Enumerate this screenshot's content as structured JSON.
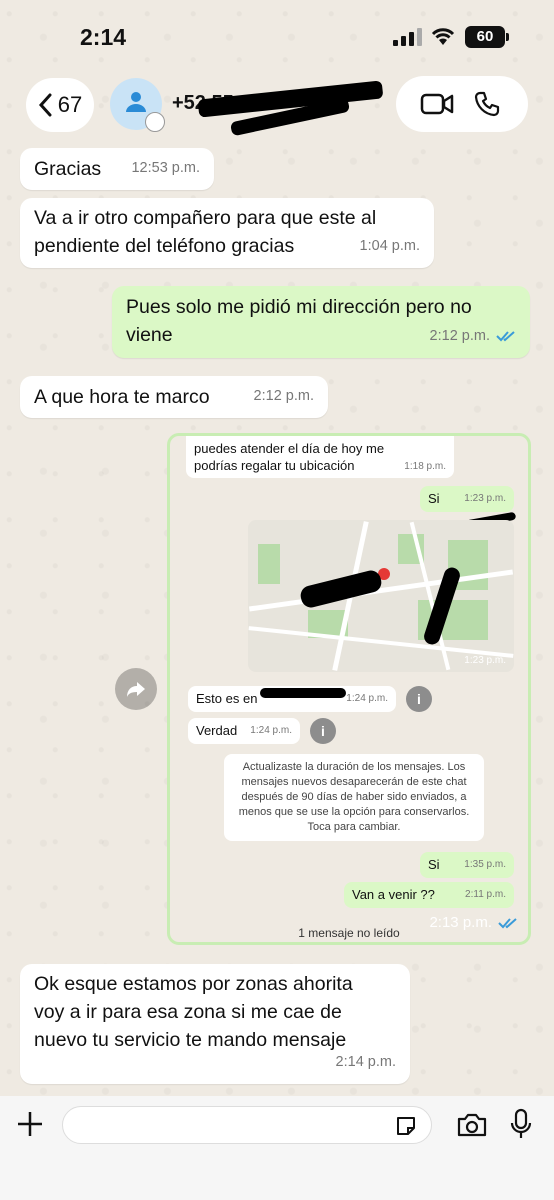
{
  "status_bar": {
    "time": "2:14",
    "battery": "60"
  },
  "header": {
    "back_count": "67",
    "contact_name": "+52 55",
    "icons": {
      "back": "chevron-left-icon",
      "video": "video-call-icon",
      "phone": "phone-icon",
      "timer": "disappearing-timer-icon"
    }
  },
  "messages": [
    {
      "dir": "in",
      "text": "Gracias",
      "time": "12:53 p.m."
    },
    {
      "dir": "in",
      "text": "Va a ir otro compañero para que este al\npendiente del teléfono gracias",
      "time": "1:04 p.m."
    },
    {
      "dir": "out",
      "text": "Pues solo me pidió mi dirección pero no\nviene",
      "time": "2:12 p.m."
    },
    {
      "dir": "in",
      "text": "A que hora te marco",
      "time": "2:12 p.m."
    },
    {
      "dir": "in",
      "text": "Ok esque estamos por zonas ahorita\nvoy a ir para esa zona si me cae de\nnuevo tu servicio te mando mensaje",
      "time": "2:14 p.m."
    }
  ],
  "embedded": {
    "msg1": {
      "text": "puedes atender el día de hoy me\npodrías regalar tu ubicación",
      "time": "1:18 p.m."
    },
    "msg2": {
      "text": "Si",
      "time": "1:23 p.m."
    },
    "map_time": "1:23 p.m.",
    "msg3": {
      "text": "Esto es en",
      "time": "1:24 p.m."
    },
    "msg4": {
      "text": "Verdad",
      "time": "1:24 p.m."
    },
    "system_note": "Actualizaste la duración de los mensajes. Los mensajes nuevos desaparecerán de este chat después de 90 días de haber sido enviados, a menos que se use la opción para conservarlos. Toca para cambiar.",
    "msg5": {
      "text": "Si",
      "time": "1:35 p.m."
    },
    "msg6": {
      "text": "Van a venir ??",
      "time": "2:11 p.m."
    },
    "unread_label": "1 mensaje no leído",
    "outer_time": "2:13 p.m."
  },
  "composer": {
    "placeholder": ""
  }
}
